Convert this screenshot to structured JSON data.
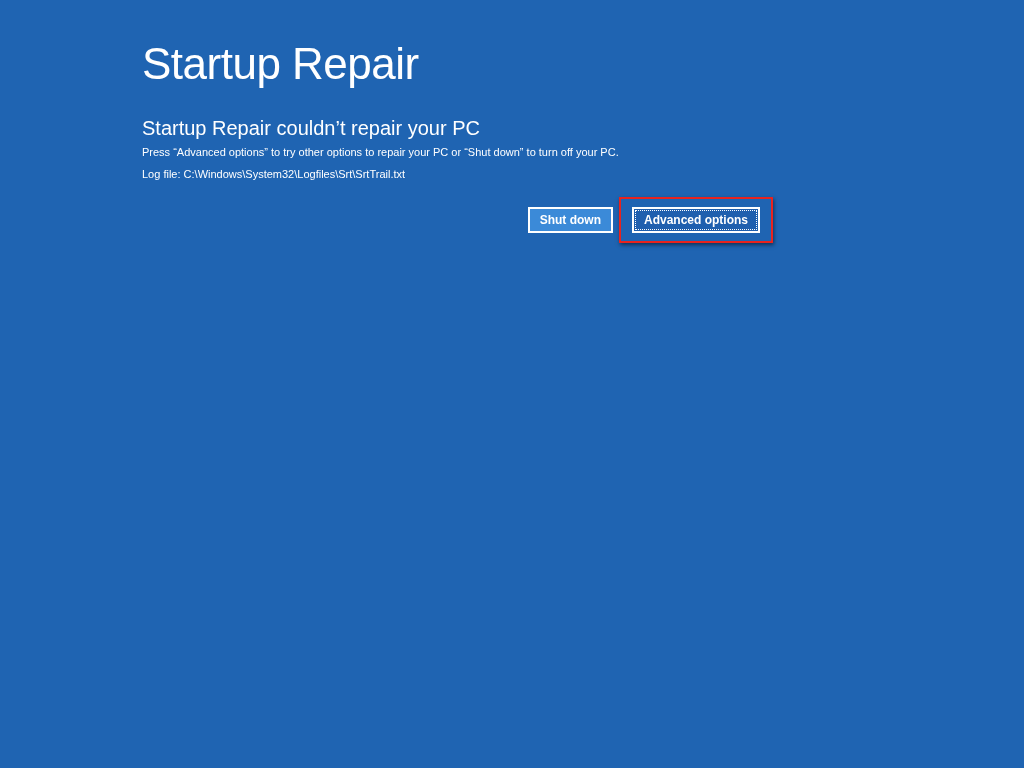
{
  "title": "Startup Repair",
  "heading": "Startup Repair couldn’t repair your PC",
  "message": "Press “Advanced options” to try other options to repair your PC or “Shut down” to turn off your PC.",
  "log_file": "Log file: C:\\Windows\\System32\\Logfiles\\Srt\\SrtTrail.txt",
  "buttons": [
    {
      "label": "Shut down",
      "focused": false,
      "highlighted": false
    },
    {
      "label": "Advanced options",
      "focused": true,
      "highlighted": true
    }
  ]
}
